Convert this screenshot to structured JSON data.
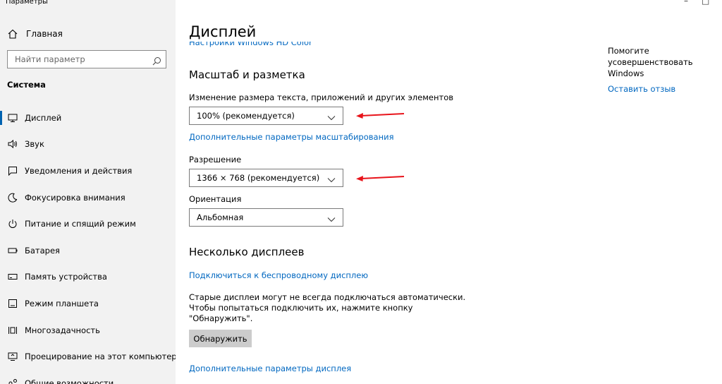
{
  "window": {
    "title": "Параметры"
  },
  "sidebar": {
    "home_label": "Главная",
    "search_placeholder": "Найти параметр",
    "section": "Система",
    "items": [
      {
        "label": "Дисплей",
        "icon": "monitor-icon",
        "active": true
      },
      {
        "label": "Звук",
        "icon": "speaker-icon"
      },
      {
        "label": "Уведомления и действия",
        "icon": "notification-icon"
      },
      {
        "label": "Фокусировка внимания",
        "icon": "moon-icon"
      },
      {
        "label": "Питание и спящий режим",
        "icon": "power-icon"
      },
      {
        "label": "Батарея",
        "icon": "battery-icon"
      },
      {
        "label": "Память устройства",
        "icon": "storage-icon"
      },
      {
        "label": "Режим планшета",
        "icon": "tablet-icon"
      },
      {
        "label": "Многозадачность",
        "icon": "multitasking-icon"
      },
      {
        "label": "Проецирование на этот компьютер",
        "icon": "projection-icon"
      },
      {
        "label": "Общие возможности",
        "icon": "shared-icon"
      }
    ]
  },
  "main": {
    "title": "Дисплей",
    "hd_color_link": "Настройки Windows HD Color",
    "scale_heading": "Масштаб и разметка",
    "scale_label": "Изменение размера текста, приложений и других элементов",
    "scale_value": "100% (рекомендуется)",
    "advanced_scale_link": "Дополнительные параметры масштабирования",
    "resolution_label": "Разрешение",
    "resolution_value": "1366 × 768 (рекомендуется)",
    "orientation_label": "Ориентация",
    "orientation_value": "Альбомная",
    "multi_heading": "Несколько дисплеев",
    "wireless_link": "Подключиться к беспроводному дисплею",
    "old_displays_text": "Старые дисплеи могут не всегда подключаться автоматически. Чтобы попытаться подключить их, нажмите кнопку \"Обнаружить\".",
    "detect_button": "Обнаружить",
    "advanced_display_link": "Дополнительные параметры дисплея"
  },
  "help": {
    "text": "Помогите усовершенствовать Windows",
    "feedback_link": "Оставить отзыв"
  },
  "colors": {
    "accent": "#0067c0",
    "annotation_arrow": "#e8141b",
    "sidebar_bg": "#f2f2f2"
  }
}
